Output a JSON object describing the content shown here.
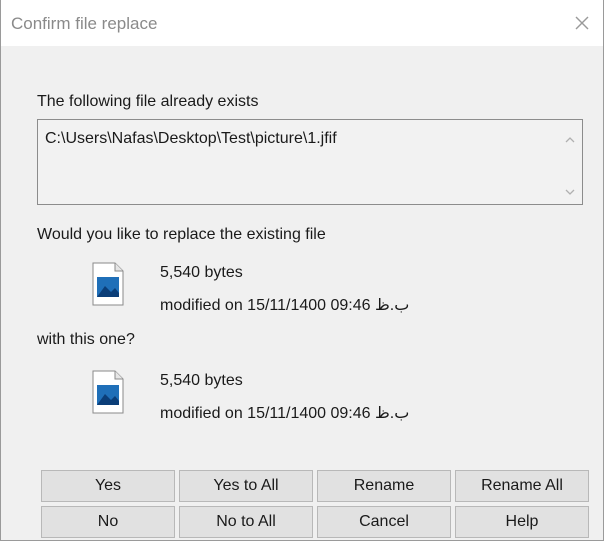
{
  "dialog": {
    "title": "Confirm file replace",
    "close_icon": "close-icon"
  },
  "existing": {
    "header": "The following file already exists",
    "path": "C:\\Users\\Nafas\\Desktop\\Test\\picture\\1.jfif"
  },
  "question": "Would you like to replace the existing file",
  "existing_file": {
    "size": "5,540 bytes",
    "modified": "modified on 15/11/1400 09:46 ب.ظ",
    "icon": "image-file-icon"
  },
  "with_label": "with this one?",
  "new_file": {
    "size": "5,540 bytes",
    "modified": "modified on 15/11/1400 09:46 ب.ظ",
    "icon": "image-file-icon"
  },
  "buttons": {
    "yes": "Yes",
    "yes_to_all": "Yes to All",
    "rename": "Rename",
    "rename_all": "Rename All",
    "no": "No",
    "no_to_all": "No to All",
    "cancel": "Cancel",
    "help": "Help"
  }
}
